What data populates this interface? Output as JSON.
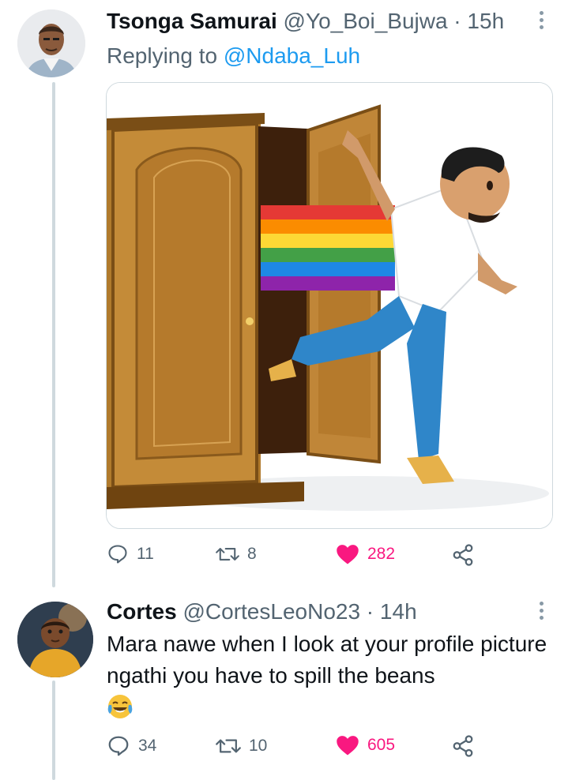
{
  "tweets": [
    {
      "author_name": "Tsonga Samurai",
      "handle": "@Yo_Boi_Bujwa",
      "separator": " · ",
      "time": "15h",
      "reply_prefix": "Replying to ",
      "reply_to": "@Ndaba_Luh",
      "media_description_icon": "coming-out-of-closet-rainbow-image",
      "stats": {
        "replies": "11",
        "retweets": "8",
        "likes": "282"
      }
    },
    {
      "author_name": "Cortes",
      "handle": "@CortesLeoNo23",
      "separator": " · ",
      "time": "14h",
      "text": "Mara nawe when I look at your profile picture ngathi you have to spill the beans",
      "emoji_icon": "face-with-tears-of-joy-emoji",
      "stats": {
        "replies": "34",
        "retweets": "10",
        "likes": "605"
      }
    }
  ],
  "colors": {
    "text": "#0f1419",
    "muted": "#536471",
    "link": "#1d9bf0",
    "like": "#f91880",
    "thread_line": "#cfd9de"
  }
}
